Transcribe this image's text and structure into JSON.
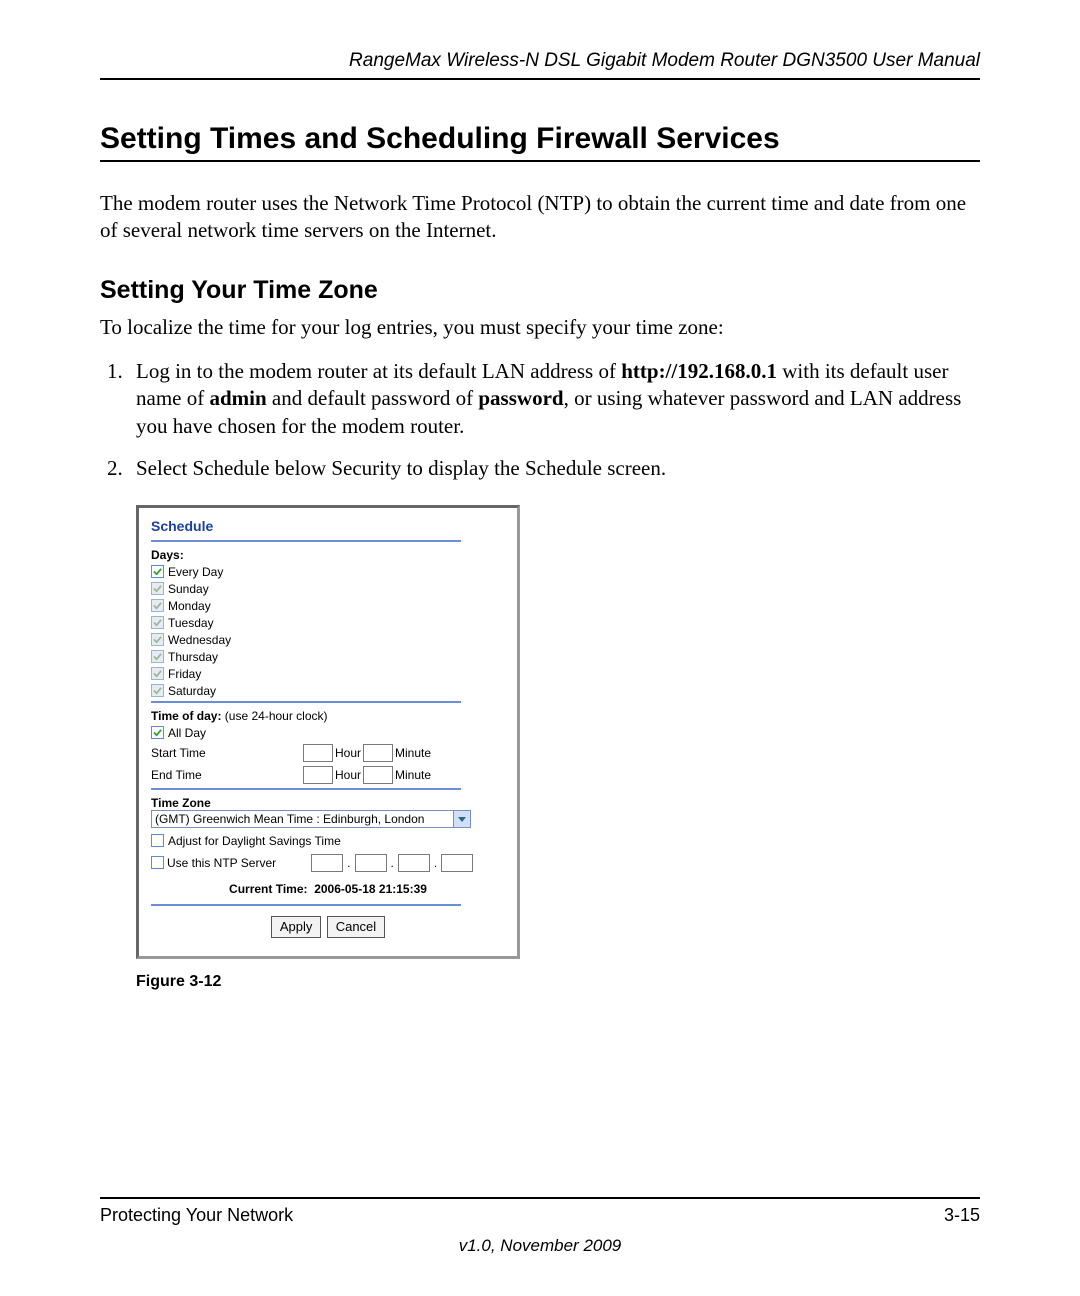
{
  "header": {
    "title": "RangeMax Wireless-N DSL Gigabit Modem Router DGN3500 User Manual"
  },
  "h1": "Setting Times and Scheduling Firewall Services",
  "para1": "The modem router uses the Network Time Protocol (NTP) to obtain the current time and date from one of several network time servers on the Internet.",
  "h2": "Setting Your Time Zone",
  "lead": "To localize the time for your log entries, you must specify your time zone:",
  "steps": {
    "s1a": "Log in to the modem router at its default LAN address of ",
    "s1b": "http://192.168.0.1",
    "s1c": " with its default user name of ",
    "s1d": "admin",
    "s1e": " and default password of ",
    "s1f": "password",
    "s1g": ", or using whatever password and LAN address you have chosen for the modem router.",
    "s2": "Select Schedule below Security to display the Schedule screen."
  },
  "shot": {
    "title": "Schedule",
    "days_label": "Days:",
    "days": {
      "every": "Every Day",
      "sun": "Sunday",
      "mon": "Monday",
      "tue": "Tuesday",
      "wed": "Wednesday",
      "thu": "Thursday",
      "fri": "Friday",
      "sat": "Saturday"
    },
    "tod_label": "Time of day:",
    "tod_hint": " (use 24-hour clock)",
    "all_day": "All Day",
    "start": "Start Time",
    "end": "End Time",
    "hour": "Hour",
    "minute": "Minute",
    "tz_label": "Time Zone",
    "tz_value": "(GMT) Greenwich Mean Time : Edinburgh, London",
    "dst": "Adjust for Daylight Savings Time",
    "ntp": "Use this NTP Server",
    "cur_lbl": "Current Time:",
    "cur_val": "2006-05-18 21:15:39",
    "apply": "Apply",
    "cancel": "Cancel"
  },
  "figure": "Figure 3-12",
  "footer": {
    "section": "Protecting Your Network",
    "page": "3-15",
    "version": "v1.0, November 2009"
  }
}
